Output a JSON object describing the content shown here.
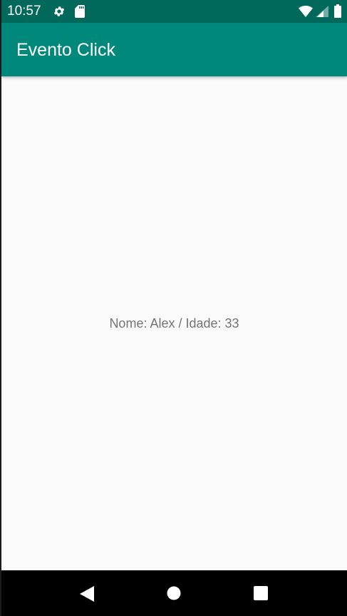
{
  "status_bar": {
    "time": "10:57",
    "icons": [
      "gear-icon",
      "sdcard-icon",
      "wifi-icon",
      "signal-icon",
      "battery-icon"
    ],
    "background": "#00695c"
  },
  "app_bar": {
    "title": "Evento Click",
    "background": "#00897b"
  },
  "main": {
    "text": "Nome: Alex / Idade: 33"
  },
  "nav_bar": {
    "buttons": [
      "back-icon",
      "home-icon",
      "recents-icon"
    ]
  },
  "colors": {
    "primary": "#00897b",
    "primary_dark": "#00695c",
    "content_background": "#fafafa",
    "body_text": "#737373"
  }
}
